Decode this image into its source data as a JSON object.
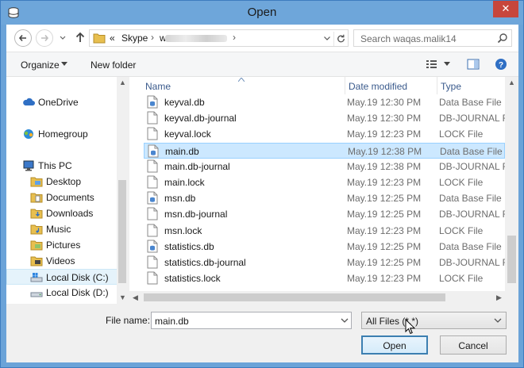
{
  "window": {
    "title": "Open",
    "close_label": "✕"
  },
  "address": {
    "prefix": "«",
    "folder": "Skype",
    "segment": "w",
    "trail_sep": "›"
  },
  "search": {
    "placeholder": "Search waqas.malik14"
  },
  "toolbar": {
    "organize_label": "Organize",
    "new_folder_label": "New folder"
  },
  "nav_pane": {
    "items": [
      {
        "label": "OneDrive",
        "icon": "cloud-icon"
      },
      {
        "label": "Homegroup",
        "icon": "homegroup-icon"
      },
      {
        "label": "This PC",
        "icon": "computer-icon"
      },
      {
        "label": "Desktop",
        "icon": "folder-icon"
      },
      {
        "label": "Documents",
        "icon": "folder-icon"
      },
      {
        "label": "Downloads",
        "icon": "folder-icon"
      },
      {
        "label": "Music",
        "icon": "folder-icon"
      },
      {
        "label": "Pictures",
        "icon": "folder-icon"
      },
      {
        "label": "Videos",
        "icon": "folder-icon"
      },
      {
        "label": "Local Disk (C:)",
        "icon": "drive-icon"
      },
      {
        "label": "Local Disk (D:)",
        "icon": "drive-icon"
      }
    ],
    "selected": "Local Disk (C:)"
  },
  "columns": {
    "name": "Name",
    "date": "Date modified",
    "type": "Type"
  },
  "files": [
    {
      "name": "keyval.db",
      "date": "May.19 12:30 PM",
      "type": "Data Base File"
    },
    {
      "name": "keyval.db-journal",
      "date": "May.19 12:30 PM",
      "type": "DB-JOURNAL File"
    },
    {
      "name": "keyval.lock",
      "date": "May.19 12:23 PM",
      "type": "LOCK File"
    },
    {
      "name": "main.db",
      "date": "May.19 12:38 PM",
      "type": "Data Base File"
    },
    {
      "name": "main.db-journal",
      "date": "May.19 12:38 PM",
      "type": "DB-JOURNAL File"
    },
    {
      "name": "main.lock",
      "date": "May.19 12:23 PM",
      "type": "LOCK File"
    },
    {
      "name": "msn.db",
      "date": "May.19 12:25 PM",
      "type": "Data Base File"
    },
    {
      "name": "msn.db-journal",
      "date": "May.19 12:25 PM",
      "type": "DB-JOURNAL File"
    },
    {
      "name": "msn.lock",
      "date": "May.19 12:23 PM",
      "type": "LOCK File"
    },
    {
      "name": "statistics.db",
      "date": "May.19 12:25 PM",
      "type": "Data Base File"
    },
    {
      "name": "statistics.db-journal",
      "date": "May.19 12:25 PM",
      "type": "DB-JOURNAL File"
    },
    {
      "name": "statistics.lock",
      "date": "May.19 12:23 PM",
      "type": "LOCK File"
    }
  ],
  "selected_file": "main.db",
  "bottom": {
    "file_name_label": "File name:",
    "file_name_value": "main.db",
    "filter_value": "All Files (*.*)",
    "open_label": "Open",
    "cancel_label": "Cancel"
  },
  "colors": {
    "accent": "#3c7fb1",
    "selection": "#cce8ff",
    "titlebar": "#6ea6da",
    "close": "#c7463c"
  }
}
